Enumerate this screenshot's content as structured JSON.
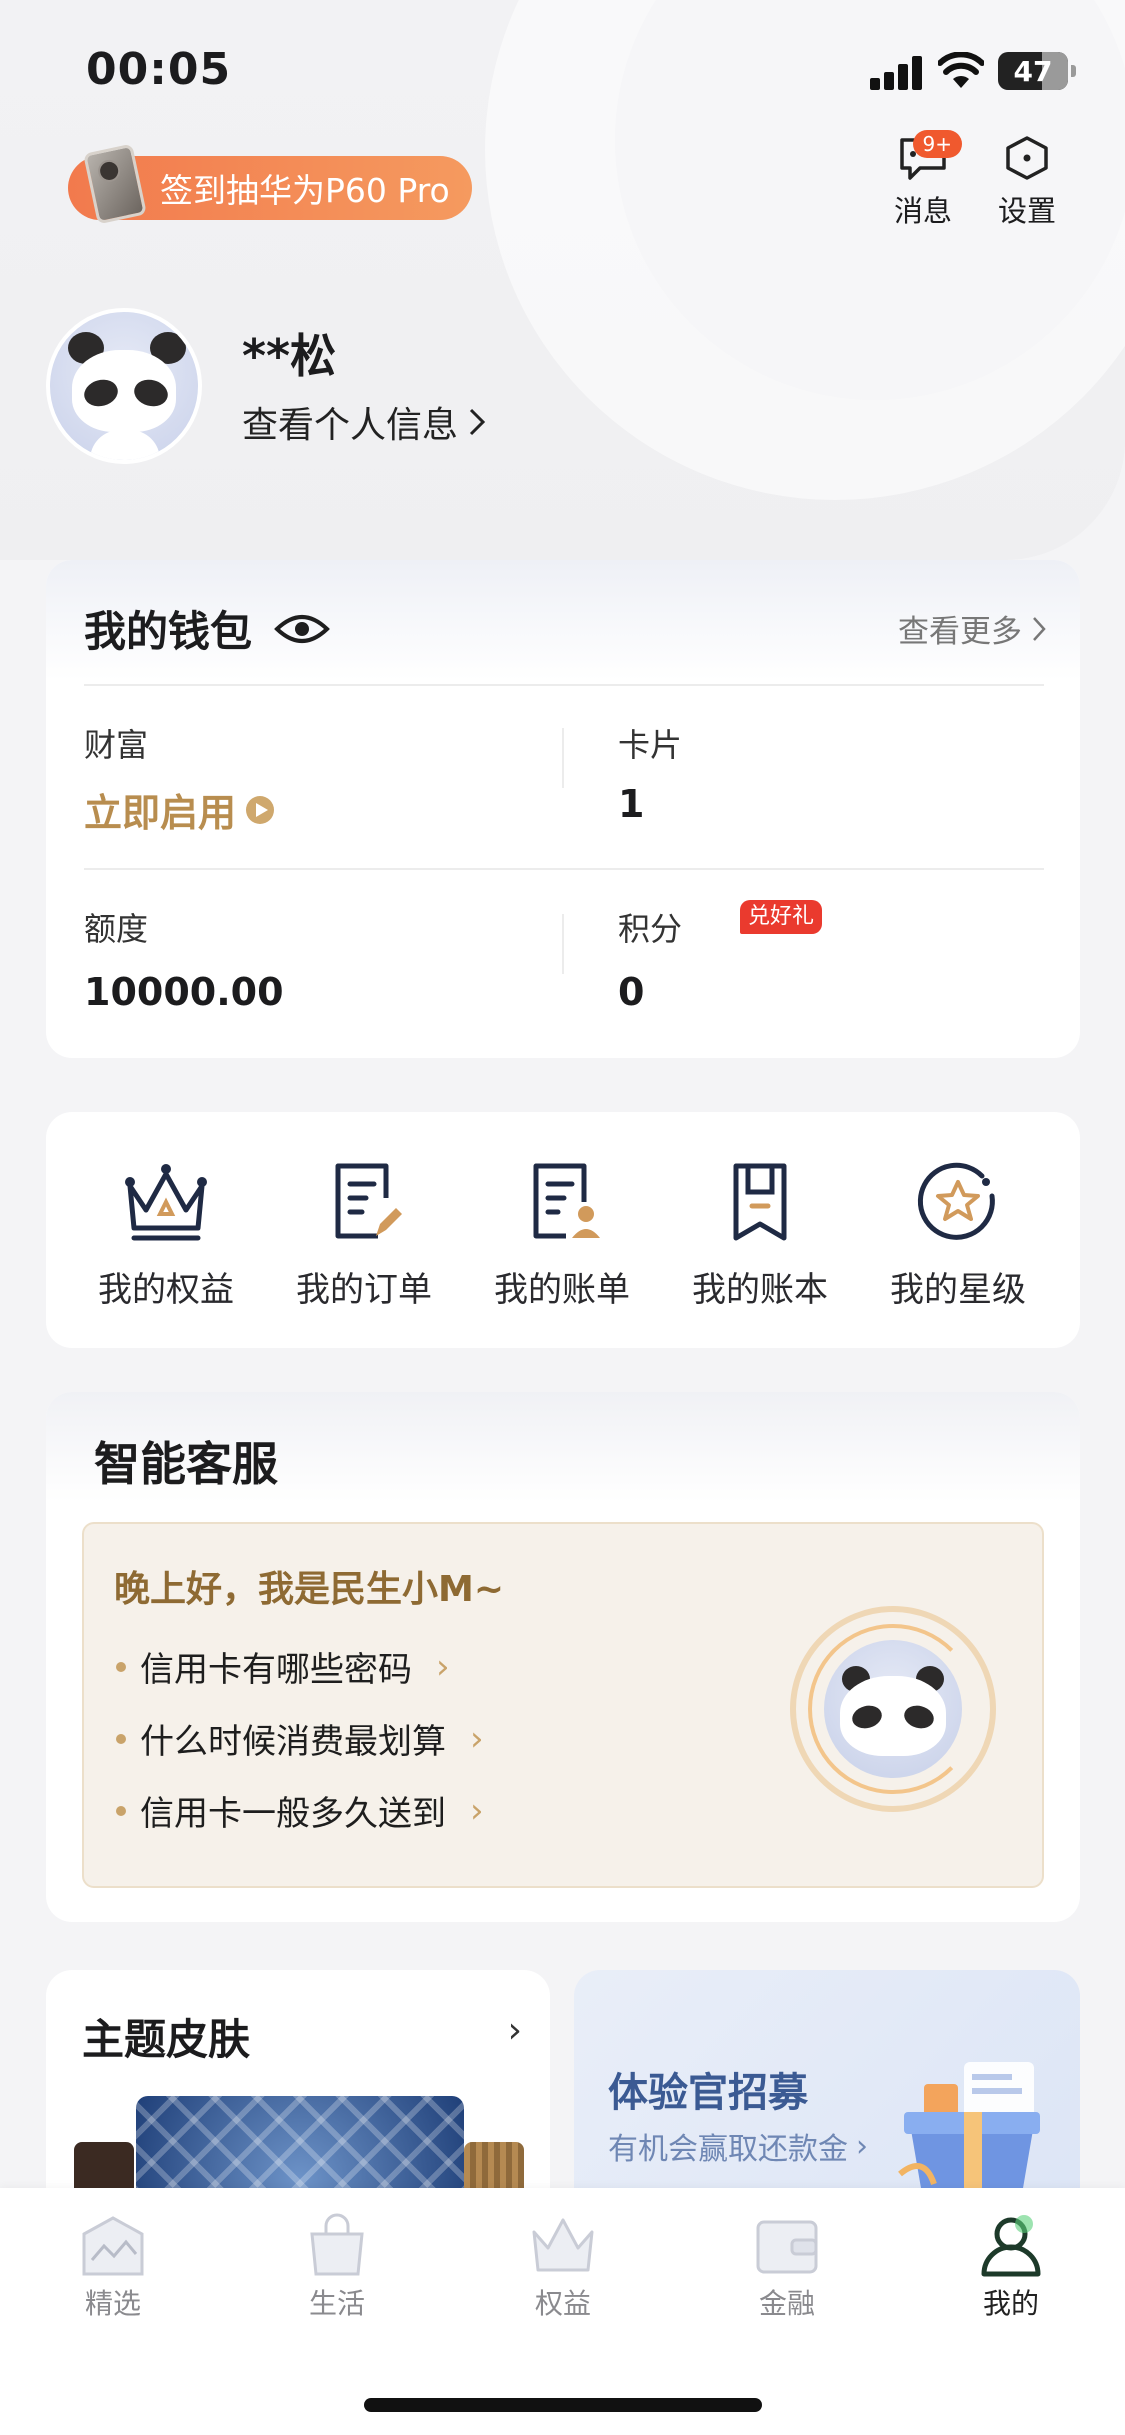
{
  "status_bar": {
    "time": "00:05",
    "battery": "47"
  },
  "promo": {
    "label": "签到抽华为P60 Pro"
  },
  "top_actions": {
    "messages_label": "消息",
    "messages_badge": "9+",
    "settings_label": "设置"
  },
  "profile": {
    "name": "**松",
    "view_info": "查看个人信息"
  },
  "wallet": {
    "title": "我的钱包",
    "more": "查看更多",
    "items": [
      {
        "label": "财富",
        "value": "立即启用"
      },
      {
        "label": "卡片",
        "value": "1"
      },
      {
        "label": "额度",
        "value": "10000.00"
      },
      {
        "label": "积分",
        "value": "0",
        "badge": "兑好礼"
      }
    ]
  },
  "quick_links": [
    {
      "label": "我的权益",
      "icon": "crown-icon"
    },
    {
      "label": "我的订单",
      "icon": "order-icon"
    },
    {
      "label": "我的账单",
      "icon": "bill-icon"
    },
    {
      "label": "我的账本",
      "icon": "ledger-icon"
    },
    {
      "label": "我的星级",
      "icon": "star-icon"
    }
  ],
  "service": {
    "title": "智能客服",
    "greeting": "晚上好，我是民生小M~",
    "questions": [
      "信用卡有哪些密码",
      "什么时候消费最划算",
      "信用卡一般多久送到"
    ]
  },
  "skin": {
    "title": "主题皮肤"
  },
  "tester": {
    "title": "体验官招募",
    "subtitle": "有机会赢取还款金"
  },
  "tabs": [
    {
      "label": "精选",
      "icon": "home-icon"
    },
    {
      "label": "生活",
      "icon": "bag-icon"
    },
    {
      "label": "权益",
      "icon": "crown-icon"
    },
    {
      "label": "金融",
      "icon": "wallet-icon"
    },
    {
      "label": "我的",
      "icon": "user-icon",
      "active": true
    }
  ],
  "colors": {
    "accent_gold": "#b88d4f",
    "promo": "#f27a4d",
    "badge_red": "#ea3a2e",
    "navy": "#1f2a44"
  }
}
